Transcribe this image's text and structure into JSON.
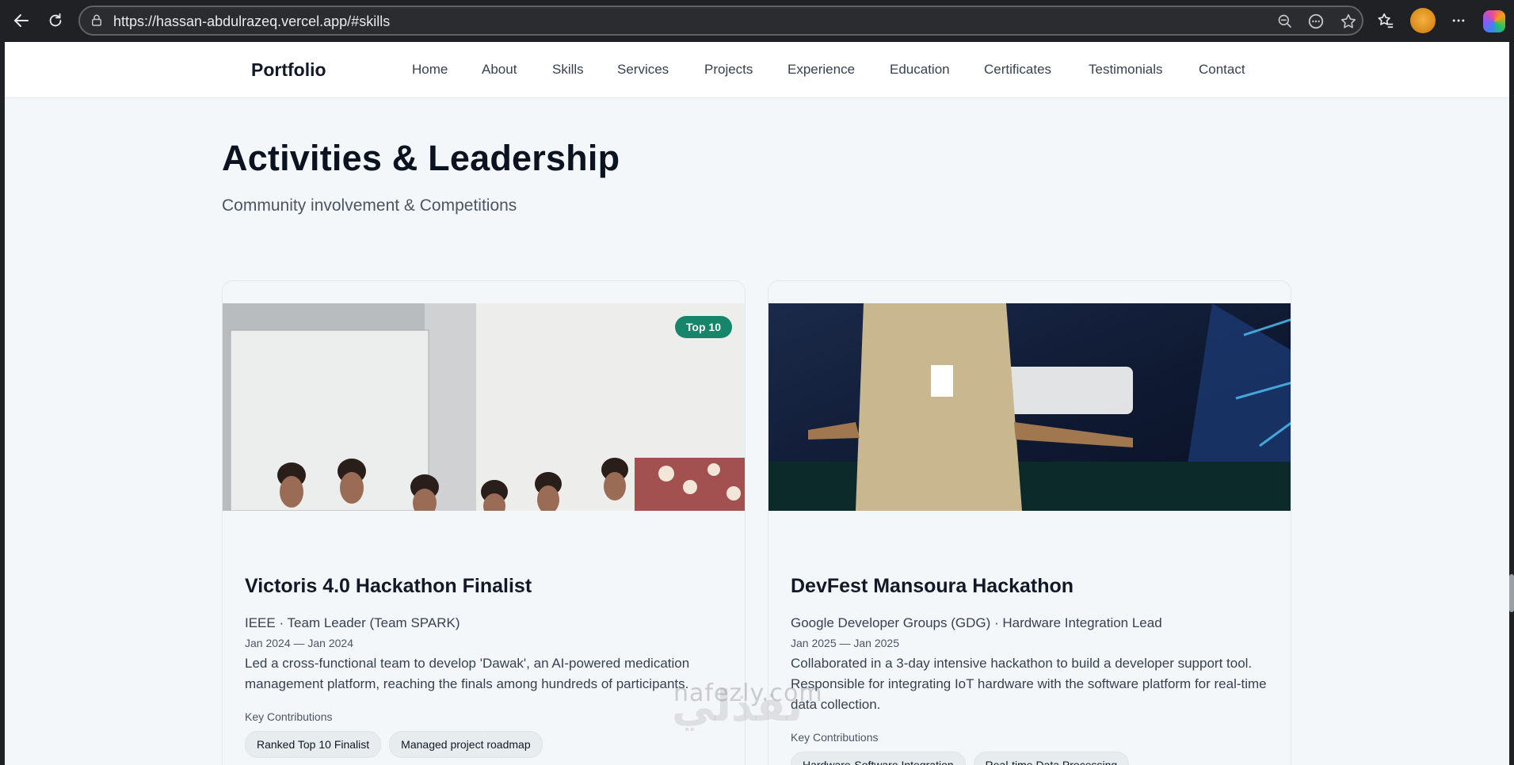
{
  "browser": {
    "url": "https://hassan-abdulrazeq.vercel.app/#skills"
  },
  "nav": {
    "brand": "Portfolio",
    "links": [
      "Home",
      "About",
      "Skills",
      "Services",
      "Projects",
      "Experience",
      "Education",
      "Certificates",
      "Testimonials",
      "Contact"
    ]
  },
  "section": {
    "title": "Activities & Leadership",
    "subtitle": "Community involvement & Competitions"
  },
  "cards": [
    {
      "badge": "Top 10",
      "title": "Victoris 4.0 Hackathon Finalist",
      "org": "IEEE · Team Leader (Team SPARK)",
      "date": "Jan 2024 — Jan 2024",
      "description": "Led a cross-functional team to develop 'Dawak', an AI-powered medication management platform, reaching the finals among hundreds of participants.",
      "contributions_label": "Key Contributions",
      "contributions": [
        "Ranked Top 10 Finalist",
        "Managed project roadmap"
      ]
    },
    {
      "title": "DevFest Mansoura Hackathon",
      "org": "Google Developer Groups (GDG) · Hardware Integration Lead",
      "date": "Jan 2025 — Jan 2025",
      "description": "Collaborated in a 3-day intensive hackathon to build a developer support tool. Responsible for integrating IoT hardware with the software platform for real-time data collection.",
      "contributions_label": "Key Contributions",
      "contributions": [
        "Hardware-Software Integration",
        "Real-time Data Processing"
      ]
    }
  ],
  "watermark": {
    "latin": "nafezly.com",
    "arabic": "نفذلي"
  },
  "colors": {
    "badge": "#16866a",
    "page_bg": "#f4f7f9",
    "chrome_bg": "#202124"
  }
}
